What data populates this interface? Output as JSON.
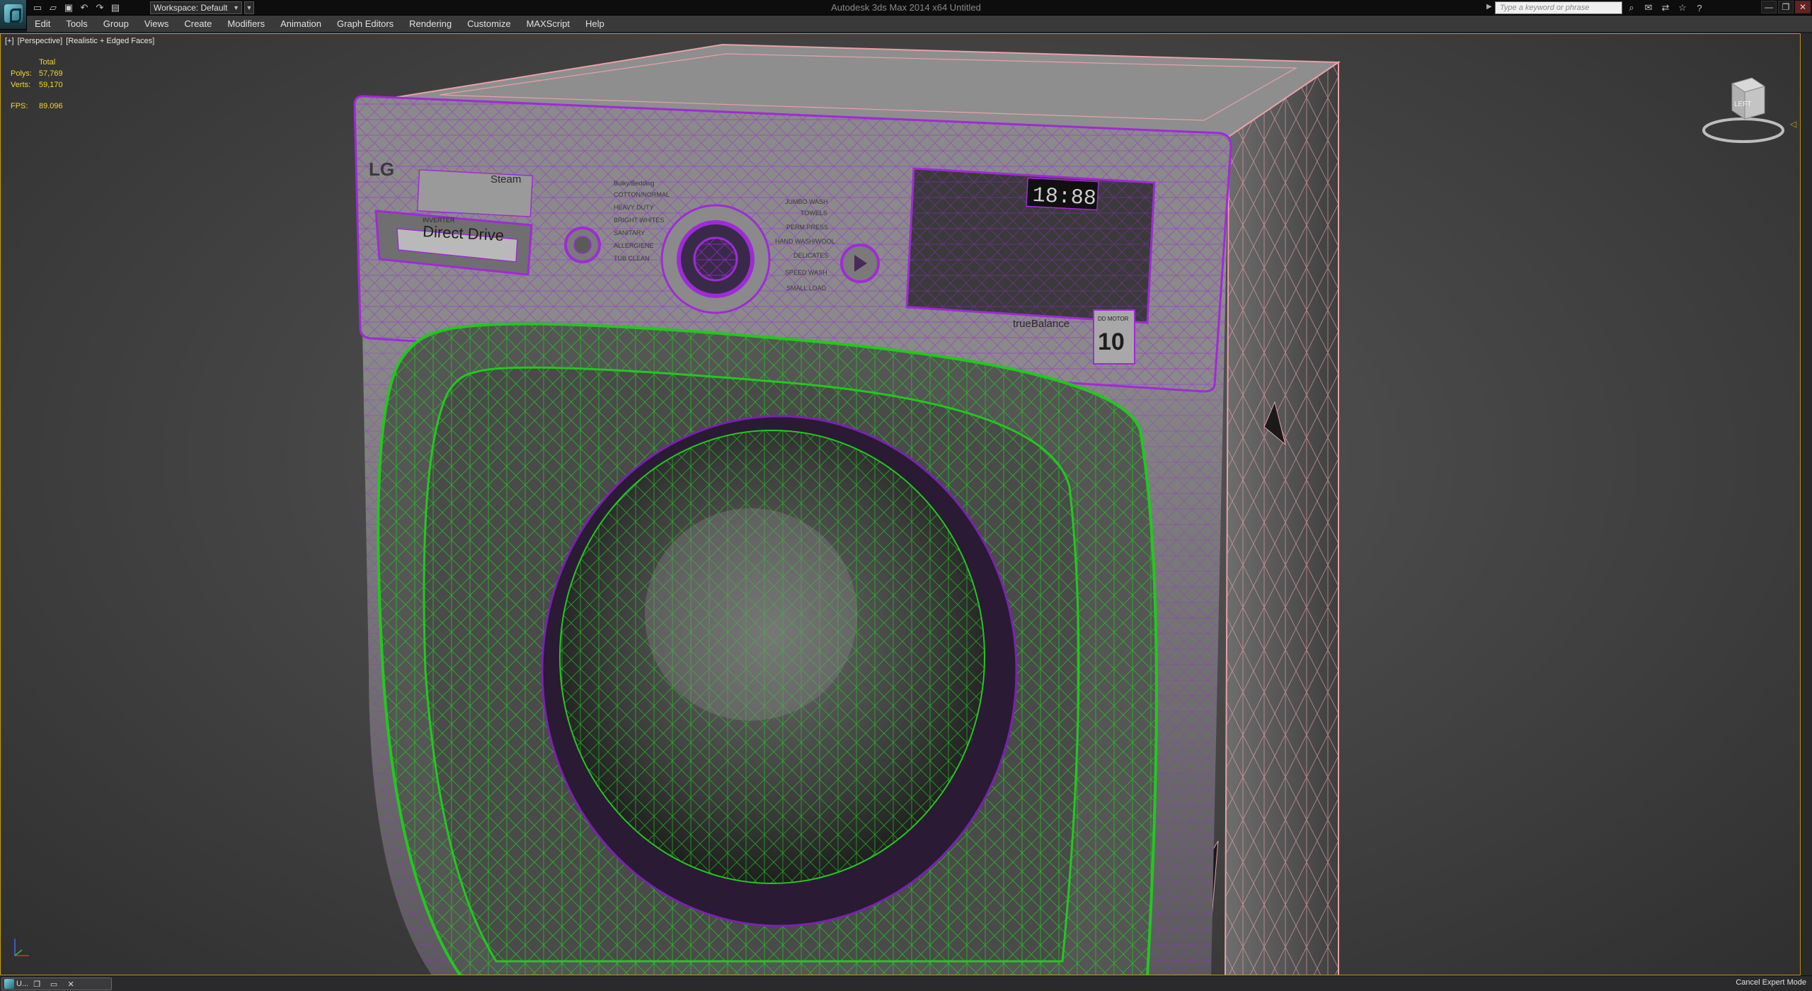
{
  "titlebar": {
    "window_title": "Autodesk 3ds Max 2014 x64     Untitled",
    "workspace_label": "Workspace: Default",
    "search_placeholder": "Type a keyword or phrase",
    "quick_access": [
      "new-icon",
      "open-icon",
      "save-icon",
      "undo-icon",
      "redo-icon",
      "project-icon"
    ],
    "info_icons": [
      "binoculars-icon",
      "communication-icon",
      "exchange-icon",
      "favorites-icon",
      "help-icon"
    ],
    "window_controls": [
      "minimize-icon",
      "restore-icon",
      "close-icon"
    ]
  },
  "menubar": {
    "items": [
      "Edit",
      "Tools",
      "Group",
      "Views",
      "Create",
      "Modifiers",
      "Animation",
      "Graph Editors",
      "Rendering",
      "Customize",
      "MAXScript",
      "Help"
    ]
  },
  "viewport": {
    "label_parts": [
      "[+]",
      "[Perspective]",
      "[Realistic + Edged Faces]"
    ],
    "stats": {
      "total_label": "Total",
      "polys_label": "Polys:",
      "polys_value": "57,769",
      "verts_label": "Verts:",
      "verts_value": "59,170",
      "fps_label": "FPS:",
      "fps_value": "89.096"
    },
    "viewcube_face": "LEFT",
    "model_labels": {
      "brand": "LG",
      "steam": "Steam",
      "inverter": "INVERTER",
      "direct_drive": "Direct Drive",
      "clock": "18:88",
      "true_balance": "trueBalance",
      "motor_badge_top": "DD MOTOR",
      "motor_badge_num": "10",
      "cycles_left": [
        "Bulky/Bedding",
        "COTTON/NORMAL",
        "HEAVY DUTY",
        "BRIGHT WHITES",
        "SANITARY",
        "ALLERGIENE",
        "TUB CLEAN"
      ],
      "cycles_right": [
        "JUMBO WASH",
        "TOWELS",
        "PERM.PRESS",
        "HAND WASH/WOOL",
        "DELICATES",
        "SPEED WASH",
        "SMALL LOAD"
      ]
    }
  },
  "statusbar": {
    "taskbar_label": "U...",
    "expert_mode": "Cancel Expert Mode"
  },
  "colors": {
    "accent_viewport_border": "#c8a000",
    "stats_text": "#f2d33a",
    "wire_purple": "#a02ad8",
    "wire_green": "#22c81e",
    "wire_pink": "#e8a0a8"
  }
}
